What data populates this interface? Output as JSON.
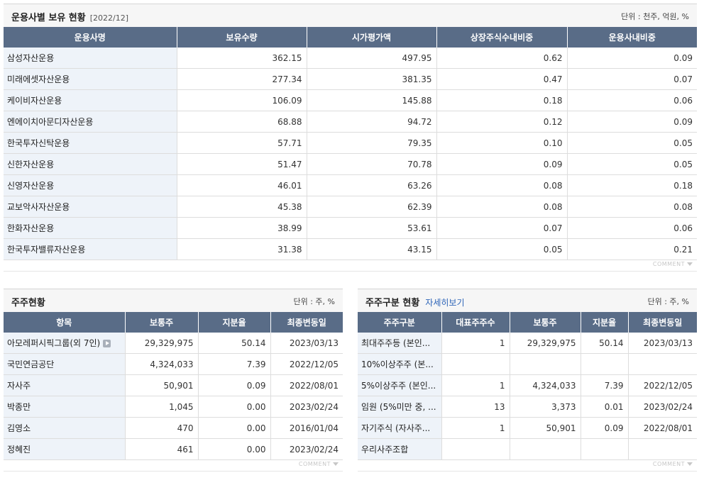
{
  "top": {
    "title": "운용사별 보유 현황",
    "period": "[2022/12]",
    "unit": "단위 : 천주, 억원, %",
    "columns": [
      "운용사명",
      "보유수량",
      "시가평가액",
      "상장주식수내비중",
      "운용사내비중"
    ],
    "rows": [
      [
        "삼성자산운용",
        "362.15",
        "497.95",
        "0.62",
        "0.09"
      ],
      [
        "미래에셋자산운용",
        "277.34",
        "381.35",
        "0.47",
        "0.07"
      ],
      [
        "케이비자산운용",
        "106.09",
        "145.88",
        "0.18",
        "0.06"
      ],
      [
        "엔에이치아문디자산운용",
        "68.88",
        "94.72",
        "0.12",
        "0.09"
      ],
      [
        "한국투자신탁운용",
        "57.71",
        "79.35",
        "0.10",
        "0.05"
      ],
      [
        "신한자산운용",
        "51.47",
        "70.78",
        "0.09",
        "0.05"
      ],
      [
        "신영자산운용",
        "46.01",
        "63.26",
        "0.08",
        "0.18"
      ],
      [
        "교보악사자산운용",
        "45.38",
        "62.39",
        "0.08",
        "0.08"
      ],
      [
        "한화자산운용",
        "38.99",
        "53.61",
        "0.07",
        "0.06"
      ],
      [
        "한국투자밸류자산운용",
        "31.38",
        "43.15",
        "0.05",
        "0.21"
      ]
    ],
    "comment": "COMMENT"
  },
  "shareholders": {
    "title": "주주현황",
    "unit": "단위 : 주, %",
    "columns": [
      "항목",
      "보통주",
      "지분율",
      "최종변동일"
    ],
    "rows": [
      [
        "아모레퍼시픽그룹(외 7인)",
        "29,329,975",
        "50.14",
        "2023/03/13"
      ],
      [
        "국민연금공단",
        "4,324,033",
        "7.39",
        "2022/12/05"
      ],
      [
        "자사주",
        "50,901",
        "0.09",
        "2022/08/01"
      ],
      [
        "박종만",
        "1,045",
        "0.00",
        "2023/02/24"
      ],
      [
        "김영소",
        "470",
        "0.00",
        "2016/01/04"
      ],
      [
        "정혜진",
        "461",
        "0.00",
        "2023/02/24"
      ]
    ],
    "comment": "COMMENT"
  },
  "groups": {
    "title": "주주구분 현황",
    "more": "자세히보기",
    "unit": "단위 : 주, %",
    "columns": [
      "주주구분",
      "대표주주수",
      "보통주",
      "지분율",
      "최종변동일"
    ],
    "rows": [
      [
        "최대주주등 (본인...",
        "1",
        "29,329,975",
        "50.14",
        "2023/03/13"
      ],
      [
        "10%이상주주 (본...",
        "",
        "",
        "",
        ""
      ],
      [
        "5%이상주주 (본인...",
        "1",
        "4,324,033",
        "7.39",
        "2022/12/05"
      ],
      [
        "임원 (5%미만 중, ...",
        "13",
        "3,373",
        "0.01",
        "2023/02/24"
      ],
      [
        "자기주식 (자사주...",
        "1",
        "50,901",
        "0.09",
        "2022/08/01"
      ],
      [
        "우리사주조합",
        "",
        "",
        "",
        ""
      ]
    ],
    "comment": "COMMENT"
  }
}
